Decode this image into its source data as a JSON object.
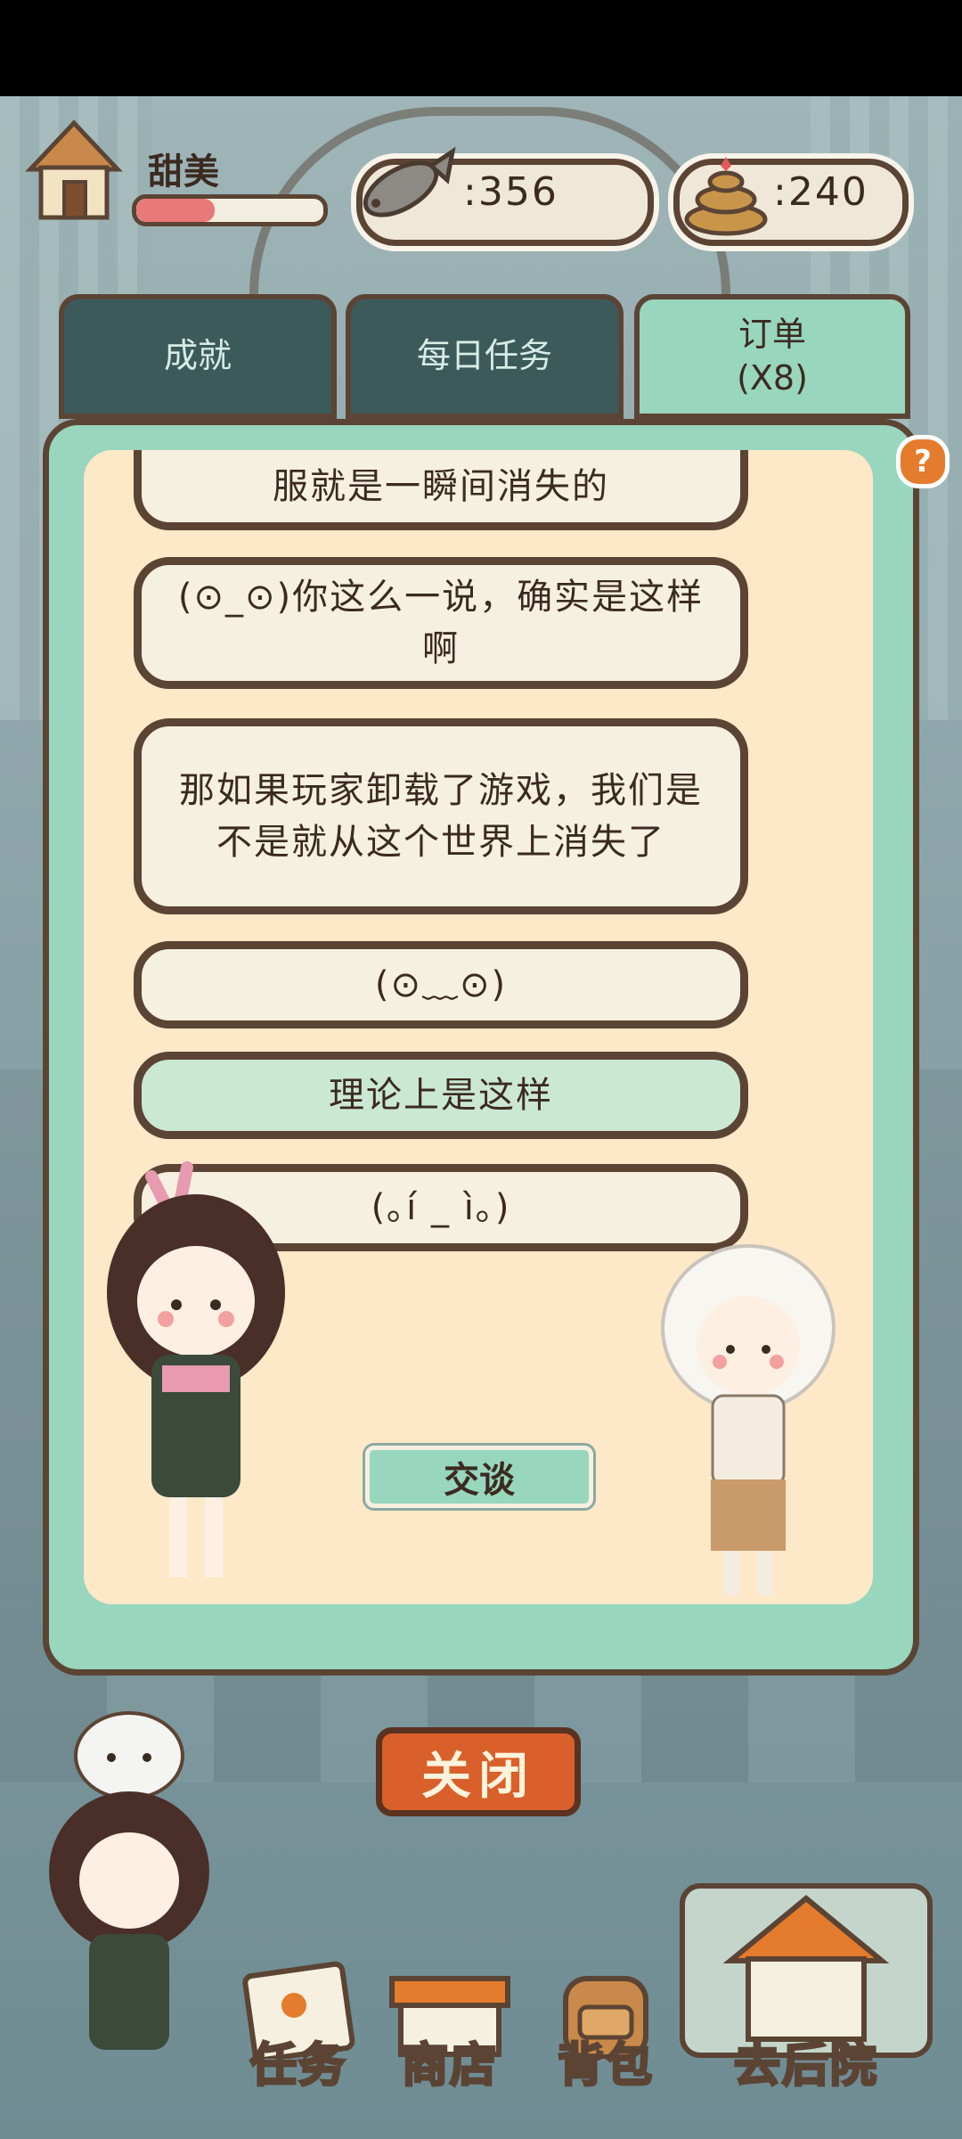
{
  "hud": {
    "player_name": "甜美",
    "hp_fraction": 0.42,
    "fish_count": "356",
    "poop_count": "240"
  },
  "tabs": [
    {
      "label": "成就"
    },
    {
      "label": "每日任务"
    },
    {
      "label": "订单\n(X8)"
    }
  ],
  "chat": {
    "cut_message": "服就是一瞬间消失的",
    "messages": [
      "(⊙_⊙)你这么一说，确实是这样啊",
      "那如果玩家卸载了游戏，我们是不是就从这个世界上消失了",
      "(⊙﹏⊙)",
      "理论上是这样",
      "(｡í _ ì｡)"
    ]
  },
  "talk_button": "交谈",
  "close_button": "关闭",
  "help_icon": "?",
  "nav": [
    {
      "label": "任务",
      "icon": "task-icon"
    },
    {
      "label": "商店",
      "icon": "shop-icon"
    },
    {
      "label": "背包",
      "icon": "backpack-icon"
    },
    {
      "label": "去后院",
      "icon": "backyard-icon"
    }
  ],
  "colors": {
    "panel_mint": "#98d6bd",
    "panel_cream": "#fde8c8",
    "outline_brown": "#5b4434",
    "close_orange": "#d9602a"
  }
}
